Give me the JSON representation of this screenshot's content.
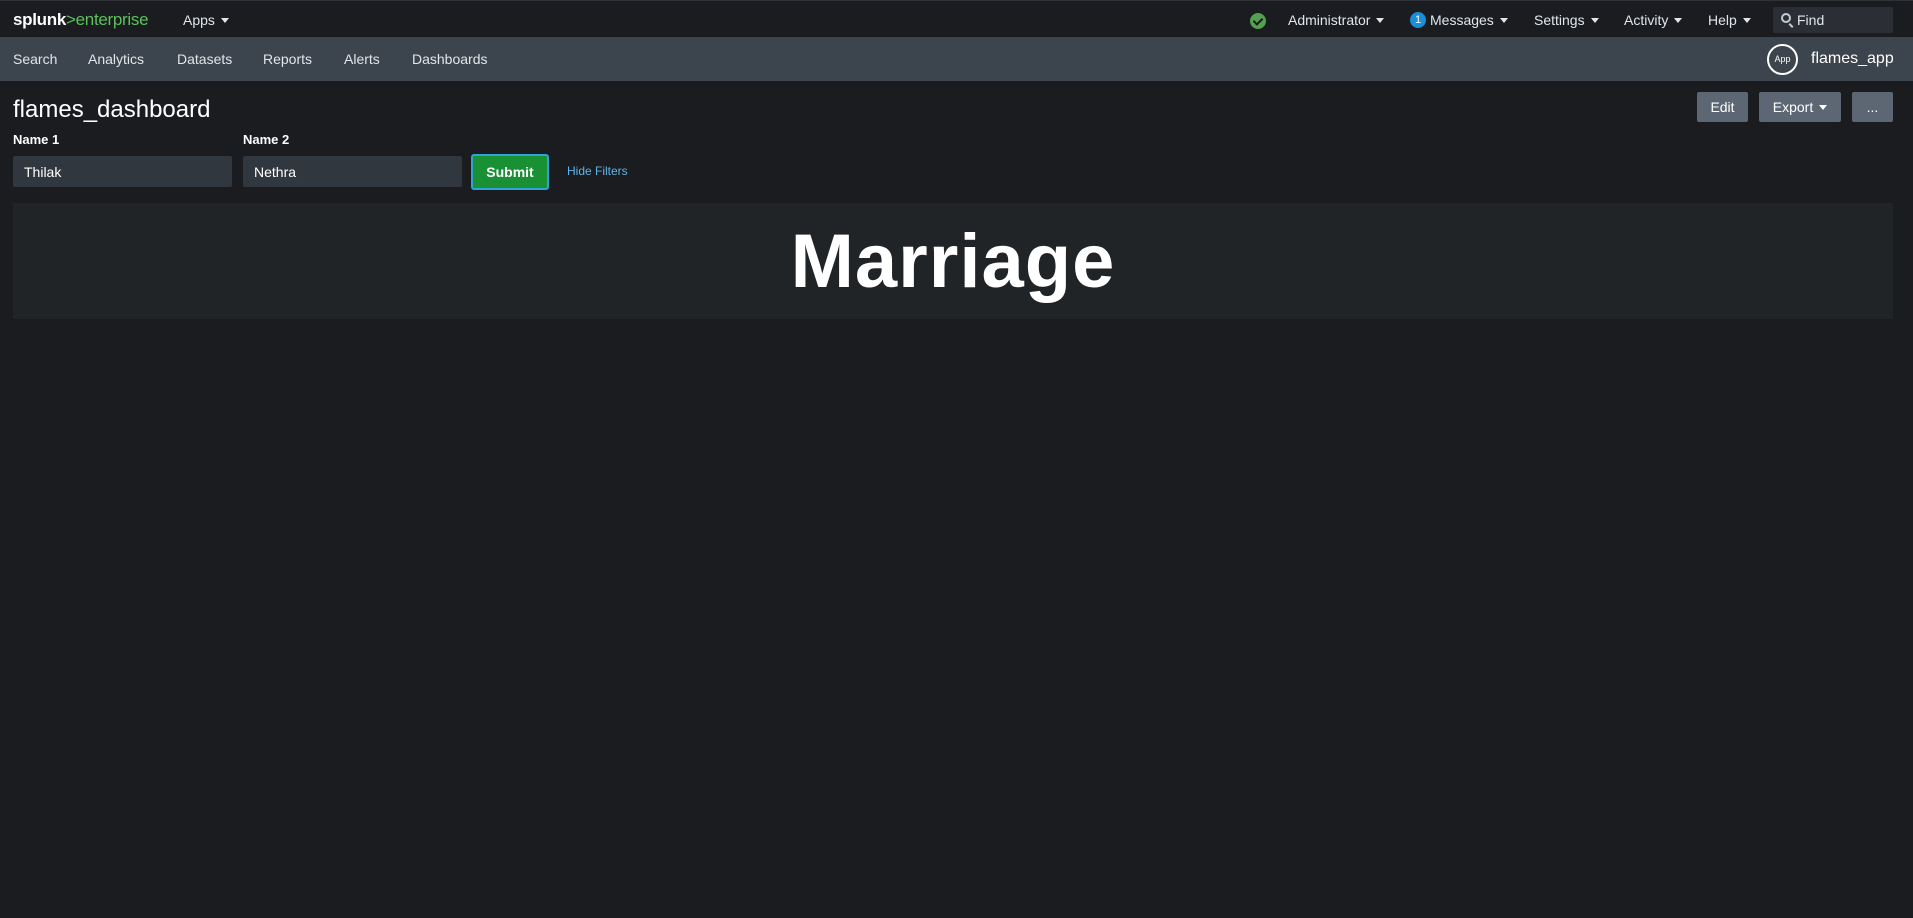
{
  "topbar": {
    "logo_splunk": "splunk",
    "logo_gt": ">",
    "logo_enterprise": "enterprise",
    "apps_label": "Apps",
    "status_icon": "check-circle-icon",
    "admin_label": "Administrator",
    "messages_count": "1",
    "messages_label": "Messages",
    "settings_label": "Settings",
    "activity_label": "Activity",
    "help_label": "Help",
    "find_placeholder": "Find"
  },
  "appbar": {
    "items": [
      "Search",
      "Analytics",
      "Datasets",
      "Reports",
      "Alerts",
      "Dashboards"
    ],
    "app_icon_text": "App",
    "app_name": "flames_app"
  },
  "dashboard": {
    "title": "flames_dashboard",
    "edit_label": "Edit",
    "export_label": "Export",
    "more_label": "...",
    "filters": {
      "name1_label": "Name 1",
      "name1_value": "Thilak",
      "name2_label": "Name 2",
      "name2_value": "Nethra",
      "submit_label": "Submit",
      "hide_filters_label": "Hide Filters"
    },
    "panel": {
      "single_value": "Marriage"
    }
  },
  "colors": {
    "background": "#1a1c20",
    "appbar": "#3c444d",
    "accent_green": "#5cc05c",
    "submit_green": "#1a9035",
    "link_blue": "#5fb3e8"
  }
}
